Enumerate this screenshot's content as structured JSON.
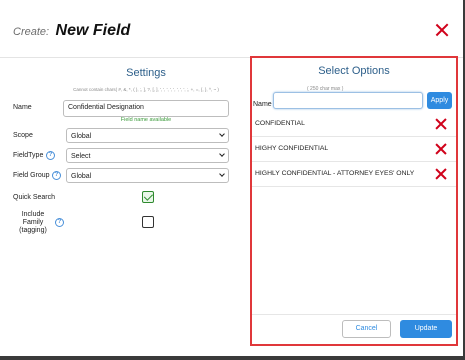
{
  "header": {
    "prefix": "Create:",
    "title": "New Field"
  },
  "settings": {
    "title": "Settings",
    "name_hint": "Cannot contain chars( #, &, *, ( ), ;, ], ?, [, ], ', ', ', ', ', ', ', ', ;, +, =, {, }, ^, ~ )",
    "name_label": "Name",
    "name_value": "Confidential Designation",
    "name_status": "Field name available",
    "scope_label": "Scope",
    "scope_value": "Global",
    "fieldtype_label": "FieldType",
    "fieldtype_value": "Select",
    "fieldgroup_label": "Field Group",
    "fieldgroup_value": "Global",
    "quicksearch_label": "Quick Search",
    "quicksearch_checked": true,
    "include_family_label": "Include Family (tagging)",
    "include_family_checked": false
  },
  "options": {
    "title": "Select Options",
    "max_hint": "( 250 char max )",
    "name_label": "Name",
    "name_value": "",
    "apply_label": "Apply",
    "items": [
      "CONFIDENTIAL",
      "HIGHY CONFIDENTIAL",
      "HIGHLY CONFIDENTIAL - ATTORNEY EYES' ONLY"
    ],
    "cancel_label": "Cancel",
    "update_label": "Update"
  },
  "colors": {
    "accent": "#2f8be0",
    "title_blue": "#2d5f8a",
    "danger": "#d0021b",
    "highlight_border": "#e0373a",
    "success": "#3a9a3a"
  }
}
